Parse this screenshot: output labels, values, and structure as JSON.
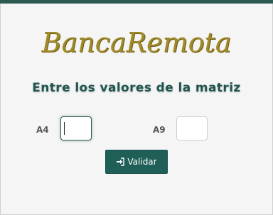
{
  "brand": {
    "logo_text": "BancaRemota",
    "accent": "#2a5a52",
    "logo_color": "#a08a2a"
  },
  "form": {
    "heading": "Entre los valores de la matriz",
    "field_a_label": "A4",
    "field_a_value": "",
    "field_b_label": "A9",
    "field_b_value": "",
    "submit_label": "Validar",
    "submit_icon": "sign-in-icon"
  }
}
